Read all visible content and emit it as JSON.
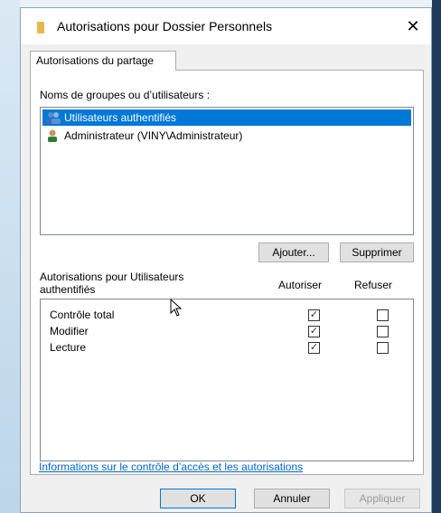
{
  "dialog": {
    "title": "Autorisations pour Dossier Personnels",
    "close_glyph": "✕",
    "tab_label": "Autorisations du partage"
  },
  "groups": {
    "label": "Noms de groupes ou d’utilisateurs :",
    "items": [
      {
        "name": "Utilisateurs authentifiés",
        "icon": "users-group-icon",
        "selected": true
      },
      {
        "name": "Administrateur (VINY\\Administrateur)",
        "icon": "user-icon",
        "selected": false
      }
    ],
    "add_label": "Ajouter...",
    "remove_label": "Supprimer"
  },
  "permissions": {
    "header_line1": "Autorisations pour Utilisateurs",
    "header_line2": "authentifiés",
    "allow_label": "Autoriser",
    "deny_label": "Refuser",
    "rows": [
      {
        "name": "Contrôle total",
        "allow": true,
        "deny": false
      },
      {
        "name": "Modifier",
        "allow": true,
        "deny": false
      },
      {
        "name": "Lecture",
        "allow": true,
        "deny": false
      }
    ]
  },
  "link_text": "Informations sur le contrôle d’accès et les autorisations",
  "footer": {
    "ok_label": "OK",
    "cancel_label": "Annuler",
    "apply_label": "Appliquer"
  },
  "colors": {
    "selection": "#0078d7",
    "link": "#0066cc"
  }
}
